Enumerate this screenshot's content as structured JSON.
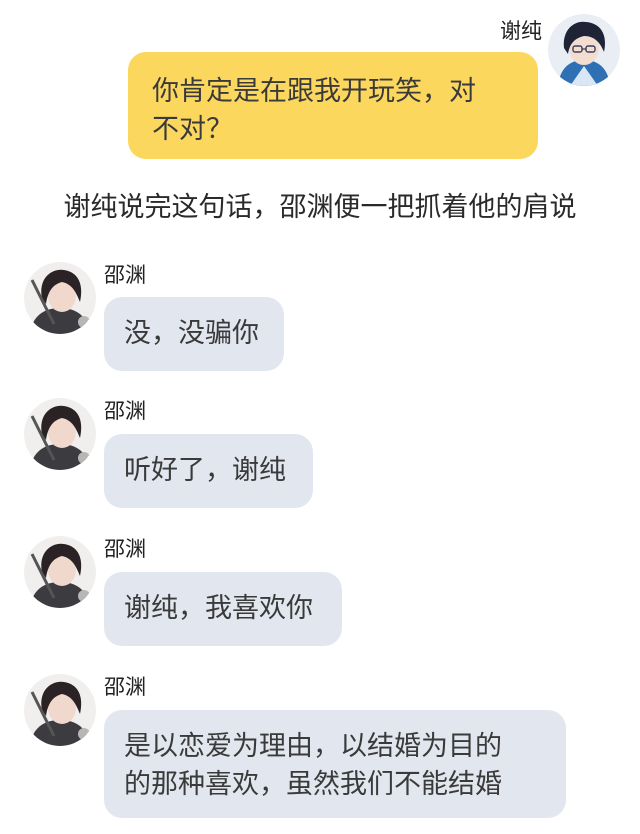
{
  "self_message": {
    "sender": "谢纯",
    "text": "你肯定是在跟我开玩笑，对\n不对？",
    "avatar_icon": "anime-boy-glasses-avatar",
    "bubble_color": "#fcd75e"
  },
  "narration": "谢纯说完这句话，邵渊便一把抓着他的肩说",
  "other_sender": "邵渊",
  "other_avatar_icon": "anime-boy-dark-hair-avatar",
  "other_bubble_color": "#e2e7ef",
  "messages": [
    {
      "sender": "邵渊",
      "text": "没，没骗你"
    },
    {
      "sender": "邵渊",
      "text": "听好了，谢纯"
    },
    {
      "sender": "邵渊",
      "text": "谢纯，我喜欢你"
    },
    {
      "sender": "邵渊",
      "text": "是以恋爱为理由，以结婚为目的\n的那种喜欢，虽然我们不能结婚"
    }
  ]
}
